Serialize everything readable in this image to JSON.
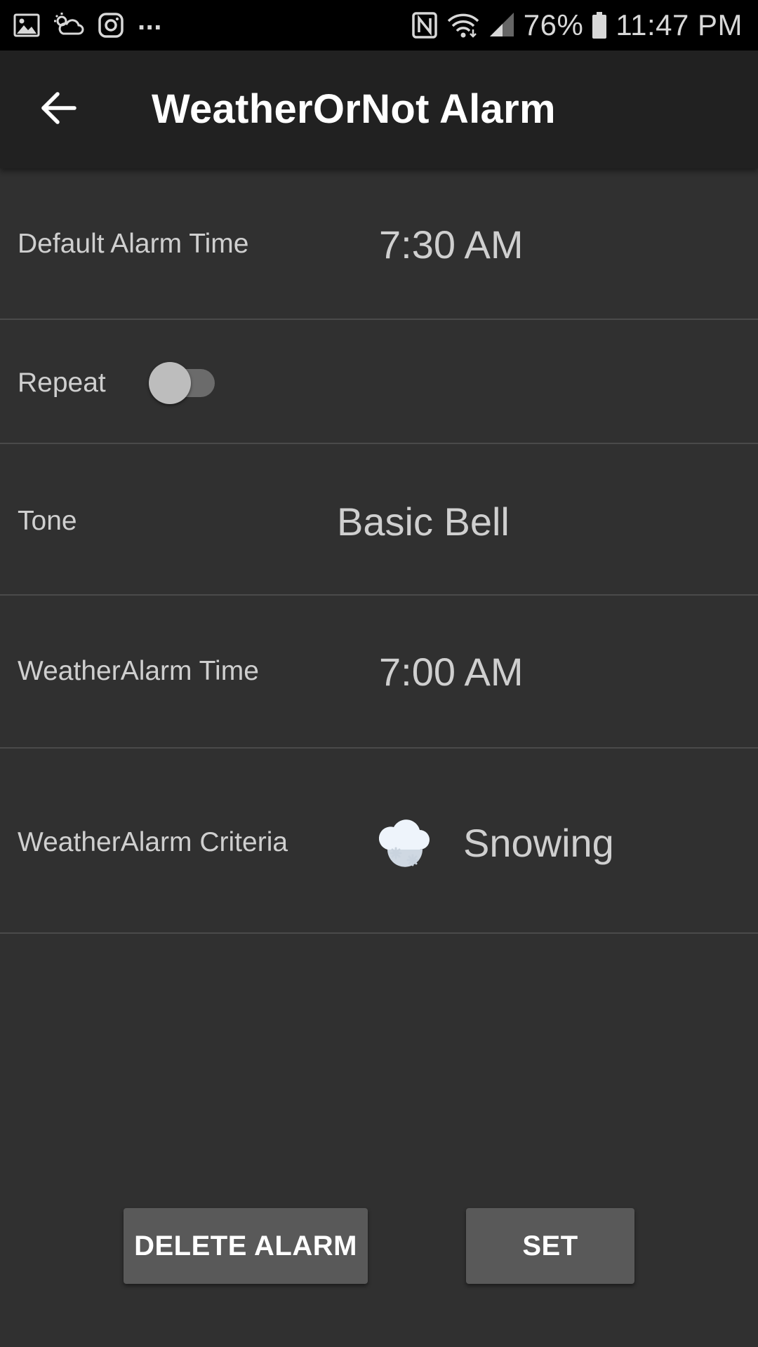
{
  "status_bar": {
    "left_icons": [
      "gallery-icon",
      "weather-icon",
      "instagram-icon"
    ],
    "more": "...",
    "right_icons": [
      "nfc-icon",
      "wifi-icon",
      "signal-icon",
      "battery-icon"
    ],
    "battery": "76%",
    "time": "11:47 PM"
  },
  "app_bar": {
    "back_icon": "arrow-left-icon",
    "title": "WeatherOrNot Alarm"
  },
  "settings": {
    "default_alarm": {
      "label": "Default Alarm Time",
      "value": "7:30 AM"
    },
    "repeat": {
      "label": "Repeat",
      "enabled": false
    },
    "tone": {
      "label": "Tone",
      "value": "Basic Bell"
    },
    "weather_alarm_time": {
      "label": "WeatherAlarm Time",
      "value": "7:00 AM"
    },
    "weather_alarm_criteria": {
      "label": "WeatherAlarm Criteria",
      "icon": "snow-cloud-icon",
      "value": "Snowing"
    }
  },
  "actions": {
    "delete_label": "DELETE ALARM",
    "set_label": "SET"
  },
  "colors": {
    "background": "#303030",
    "app_bar": "#212121",
    "status_bar": "#000000",
    "button": "#595959",
    "divider": "#4a4a4a",
    "text": "#cfcfcf"
  }
}
